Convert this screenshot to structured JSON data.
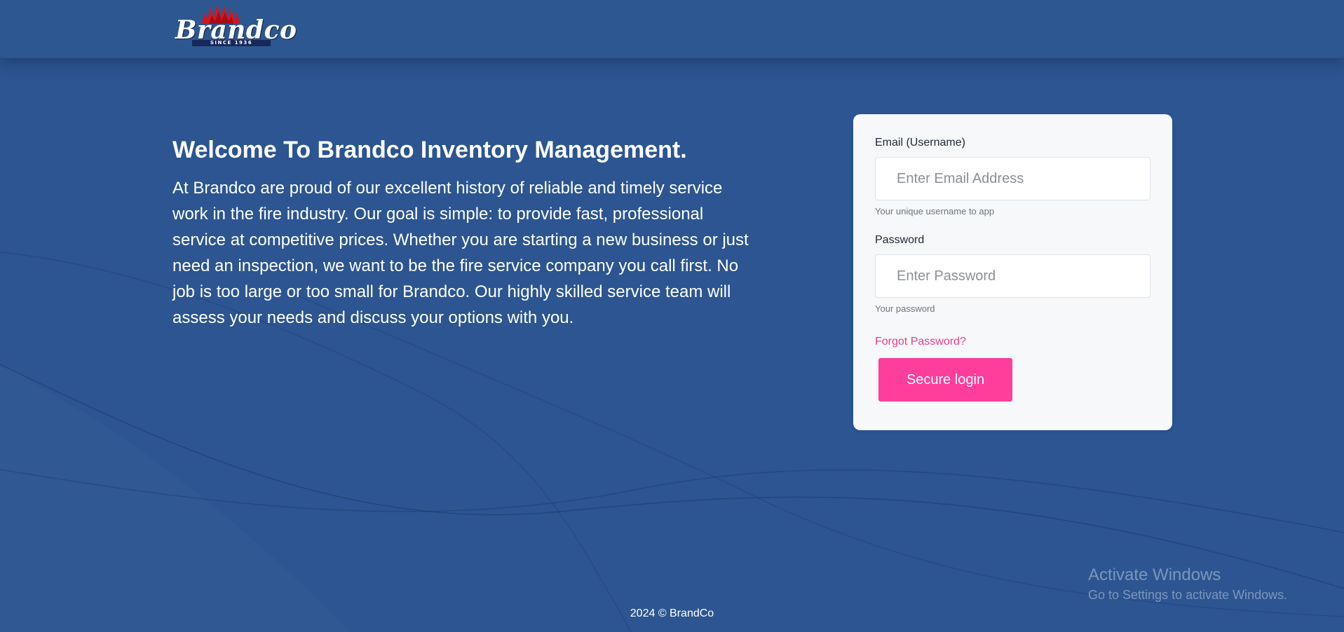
{
  "header": {
    "logo": {
      "wordmark": "Brandco",
      "tagline": "SINCE 1936"
    }
  },
  "intro": {
    "heading": "Welcome To Brandco Inventory Management.",
    "body": "At Brandco are proud of our excellent history of reliable and timely service work in the fire industry. Our goal is simple: to provide fast, professional service at competitive prices. Whether you are starting a new business or just need an inspection, we want to be the fire service company you call first. No job is too large or too small for Brandco. Our highly skilled service team will assess your needs and discuss your options with you."
  },
  "login": {
    "email": {
      "label": "Email (Username)",
      "placeholder": "Enter Email Address",
      "value": "",
      "help": "Your unique username to app"
    },
    "password": {
      "label": "Password",
      "placeholder": "Enter Password",
      "value": "",
      "help": "Your password"
    },
    "forgot_label": "Forgot Password?",
    "submit_label": "Secure login"
  },
  "footer": {
    "text": "2024 © BrandCo"
  },
  "watermark": {
    "title": "Activate Windows",
    "subtitle": "Go to Settings to activate Windows."
  },
  "colors": {
    "background": "#2c5591",
    "accent": "#ff3d9a",
    "link": "#e83e8c",
    "card": "#f7f8fa"
  }
}
